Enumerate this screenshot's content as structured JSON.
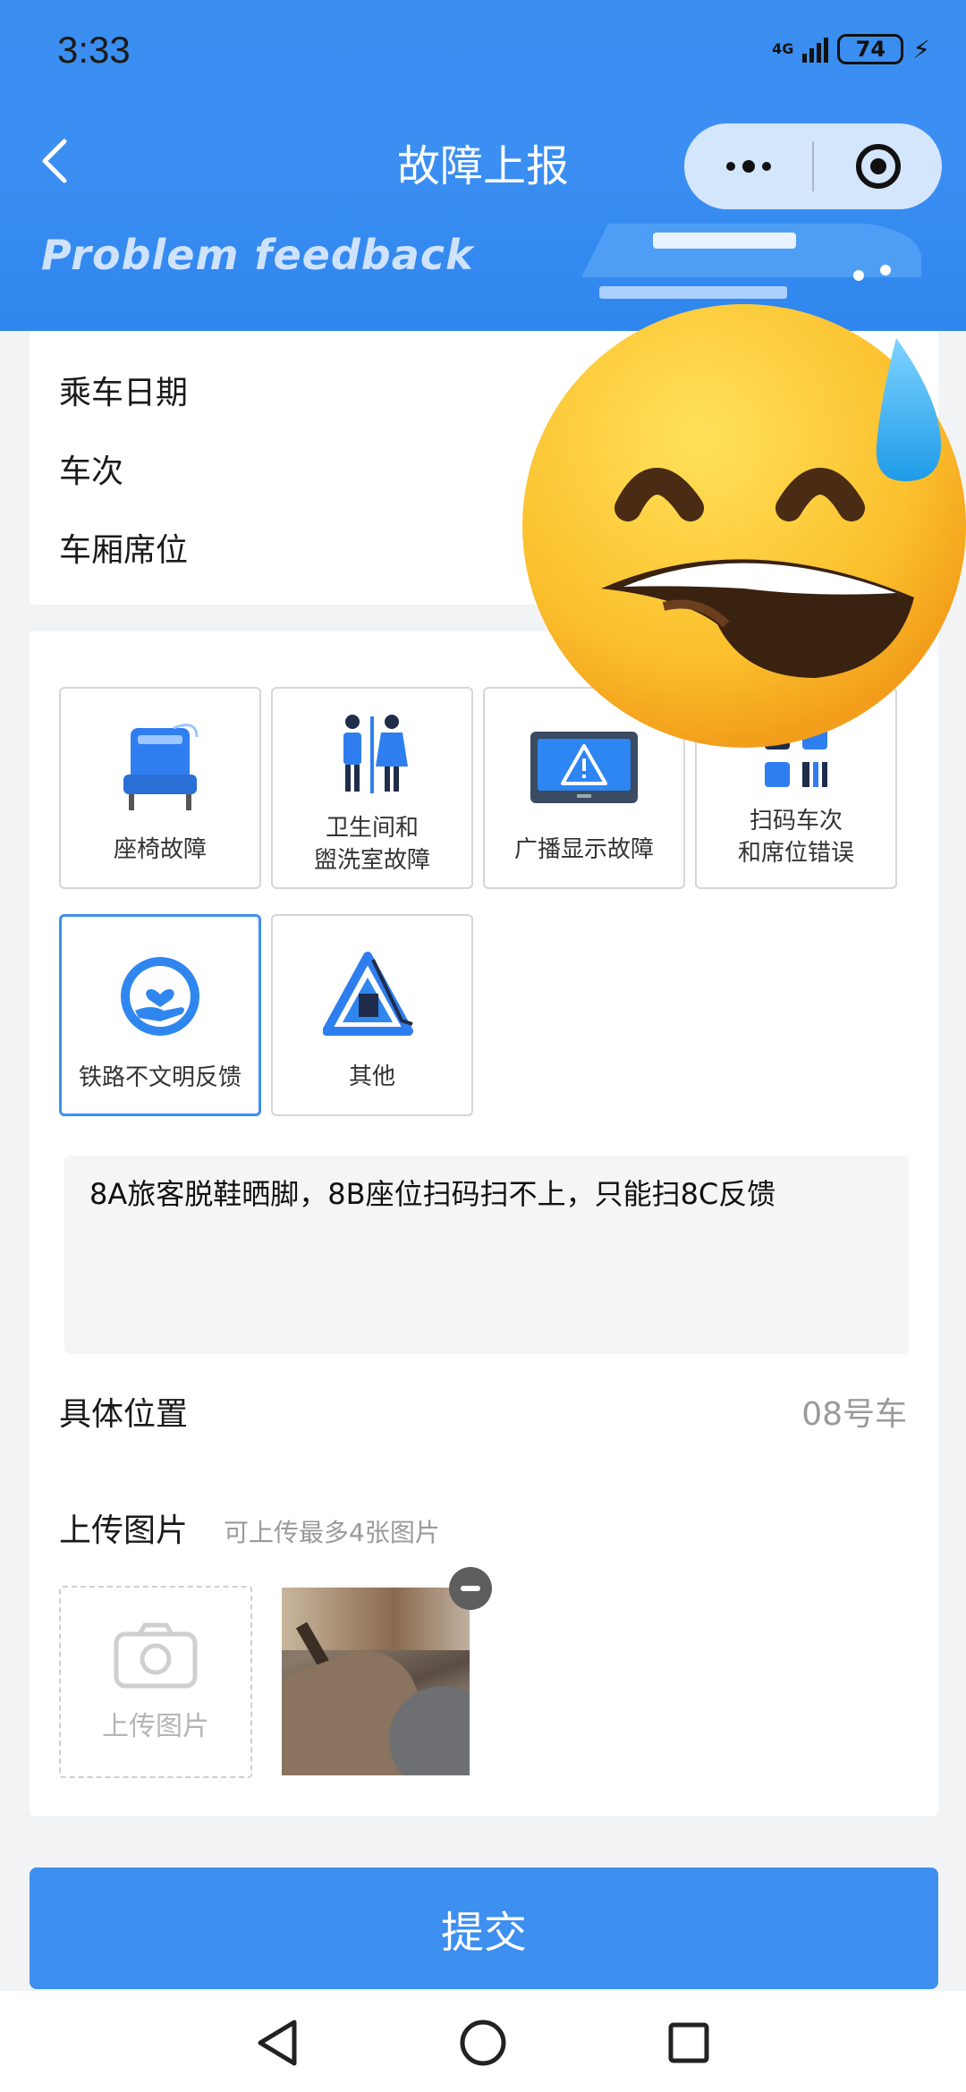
{
  "status_bar": {
    "time": "3:33",
    "network": "4G",
    "battery": "74"
  },
  "nav": {
    "title": "故障上报"
  },
  "banner": {
    "text": "Problem feedback"
  },
  "info": {
    "ride_date_label": "乘车日期",
    "train_no_label": "车次",
    "seat_label": "车厢席位"
  },
  "categories": [
    {
      "label": "座椅故障",
      "icon": "seat-icon",
      "selected": false
    },
    {
      "label": "卫生间和\n盥洗室故障",
      "icon": "restroom-icon",
      "selected": false
    },
    {
      "label": "广播显示故障",
      "icon": "display-warning-icon",
      "selected": false
    },
    {
      "label": "扫码车次\n和席位错误",
      "icon": "qr-code-icon",
      "selected": false
    },
    {
      "label": "铁路不文明反馈",
      "icon": "heart-hand-icon",
      "selected": true
    },
    {
      "label": "其他",
      "icon": "warning-triangle-icon",
      "selected": false
    }
  ],
  "description": {
    "text": "8A旅客脱鞋晒脚，8B座位扫码扫不上，只能扫8C反馈"
  },
  "location": {
    "label": "具体位置",
    "value": "08号车"
  },
  "upload": {
    "label": "上传图片",
    "hint": "可上传最多4张图片",
    "box_label": "上传图片"
  },
  "submit": {
    "label": "提交"
  },
  "colors": {
    "primary": "#3d8ff0",
    "header": "#3a8ef0"
  }
}
